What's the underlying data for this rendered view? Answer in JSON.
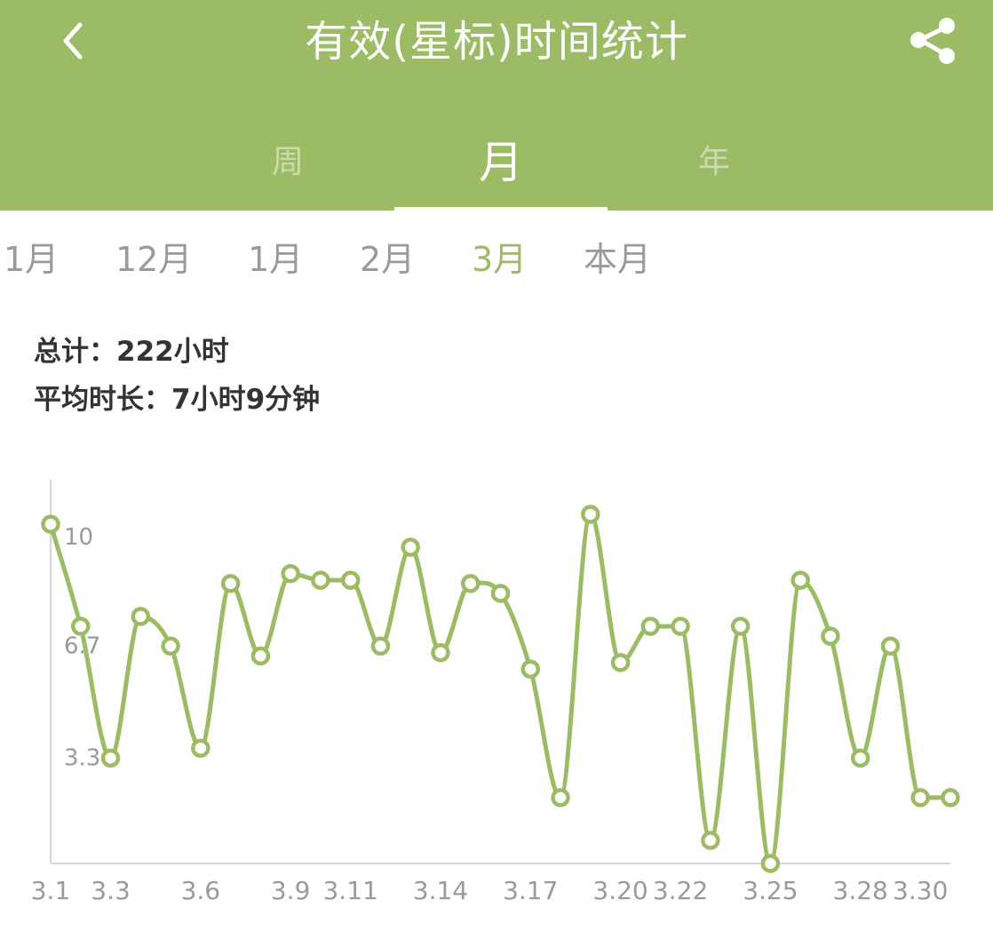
{
  "header": {
    "title": "有效(星标)时间统计",
    "tabs": [
      {
        "label": "周"
      },
      {
        "label": "月"
      },
      {
        "label": "年"
      }
    ],
    "active_tab": 1
  },
  "month_selector": {
    "items": [
      "1月",
      "12月",
      "1月",
      "2月",
      "3月",
      "本月"
    ],
    "selected_index": 4
  },
  "summary": {
    "total": "总计：222小时",
    "average": "平均时长：7小时9分钟"
  },
  "colors": {
    "accent": "#9bbb65",
    "tab_inactive": "#c9dcb0",
    "text_dark": "#333333",
    "text_muted": "#9a9a9a"
  },
  "chart_data": {
    "type": "line",
    "smooth": true,
    "x_ticks": [
      "3.1",
      "3.3",
      "3.6",
      "3.9",
      "3.11",
      "3.14",
      "3.17",
      "3.20",
      "3.22",
      "3.25",
      "3.28",
      "3.30"
    ],
    "y_ticks": [
      "3.3",
      "6.7",
      "10"
    ],
    "ylim": [
      0,
      11.3
    ],
    "values": [
      10.3,
      7.2,
      3.2,
      7.5,
      6.6,
      3.5,
      8.5,
      6.3,
      8.8,
      8.6,
      8.6,
      6.6,
      9.6,
      6.4,
      8.5,
      8.2,
      5.9,
      2.0,
      10.6,
      6.1,
      7.2,
      7.2,
      0.7,
      7.2,
      0.0,
      8.6,
      6.9,
      3.2,
      6.6,
      2.0,
      2.0
    ],
    "grid": false
  }
}
